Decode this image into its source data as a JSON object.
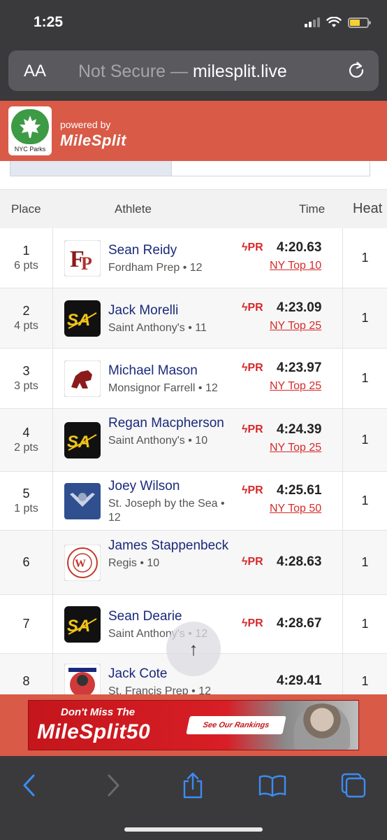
{
  "status": {
    "time": "1:25"
  },
  "browser": {
    "text_size_label": "AA",
    "security": "Not Secure",
    "separator": " — ",
    "domain": "milesplit.live"
  },
  "site": {
    "logo_text": "NYC Parks",
    "powered_by": "powered by",
    "brand": "MileSplit"
  },
  "table": {
    "headers": {
      "place": "Place",
      "athlete": "Athlete",
      "time": "Time",
      "heat": "Heat"
    },
    "rows": [
      {
        "place": "1",
        "pts": "6 pts",
        "name": "Sean Reidy",
        "school": "Fordham Prep • 12",
        "pr": "PR",
        "time": "4:20.63",
        "rank": "NY Top 10",
        "heat": "1",
        "logo": "fordham-prep-logo"
      },
      {
        "place": "2",
        "pts": "4 pts",
        "name": "Jack Morelli",
        "school": "Saint Anthony's • 11",
        "pr": "PR",
        "time": "4:23.09",
        "rank": "NY Top 25",
        "heat": "1",
        "logo": "saint-anthonys-logo"
      },
      {
        "place": "3",
        "pts": "3 pts",
        "name": "Michael Mason",
        "school": "Monsignor Farrell • 12",
        "pr": "PR",
        "time": "4:23.97",
        "rank": "NY Top 25",
        "heat": "1",
        "logo": "monsignor-farrell-logo"
      },
      {
        "place": "4",
        "pts": "2 pts",
        "name": "Regan Macpherson",
        "school": "Saint Anthony's • 10",
        "pr": "PR",
        "time": "4:24.39",
        "rank": "NY Top 25",
        "heat": "1",
        "logo": "saint-anthonys-logo"
      },
      {
        "place": "5",
        "pts": "1 pts",
        "name": "Joey Wilson",
        "school": "St. Joseph by the Sea • 12",
        "pr": "PR",
        "time": "4:25.61",
        "rank": "NY Top 50",
        "heat": "1",
        "logo": "st-joseph-logo"
      },
      {
        "place": "6",
        "pts": "",
        "name": "James Stappenbeck",
        "school": "Regis • 10",
        "pr": "PR",
        "time": "4:28.63",
        "rank": "",
        "heat": "1",
        "logo": "regis-logo"
      },
      {
        "place": "7",
        "pts": "",
        "name": "Sean Dearie",
        "school": "Saint Anthony's • 12",
        "pr": "PR",
        "time": "4:28.67",
        "rank": "",
        "heat": "1",
        "logo": "saint-anthonys-logo"
      },
      {
        "place": "8",
        "pts": "",
        "name": "Jack Cote",
        "school": "St. Francis Prep • 12",
        "pr": "",
        "time": "4:29.41",
        "rank": "",
        "heat": "1",
        "logo": "st-francis-prep-logo"
      }
    ]
  },
  "scroll_top": {
    "icon": "arrow-up-icon",
    "glyph": "↑"
  },
  "ad": {
    "line1": "Don't Miss The",
    "line2": "MileSplit50",
    "cta": "See Our Rankings"
  },
  "colors": {
    "brand_red": "#d85a47",
    "link_red": "#d62a2a",
    "name_blue": "#1a2a7a",
    "ios_blue": "#3c8cf4"
  }
}
